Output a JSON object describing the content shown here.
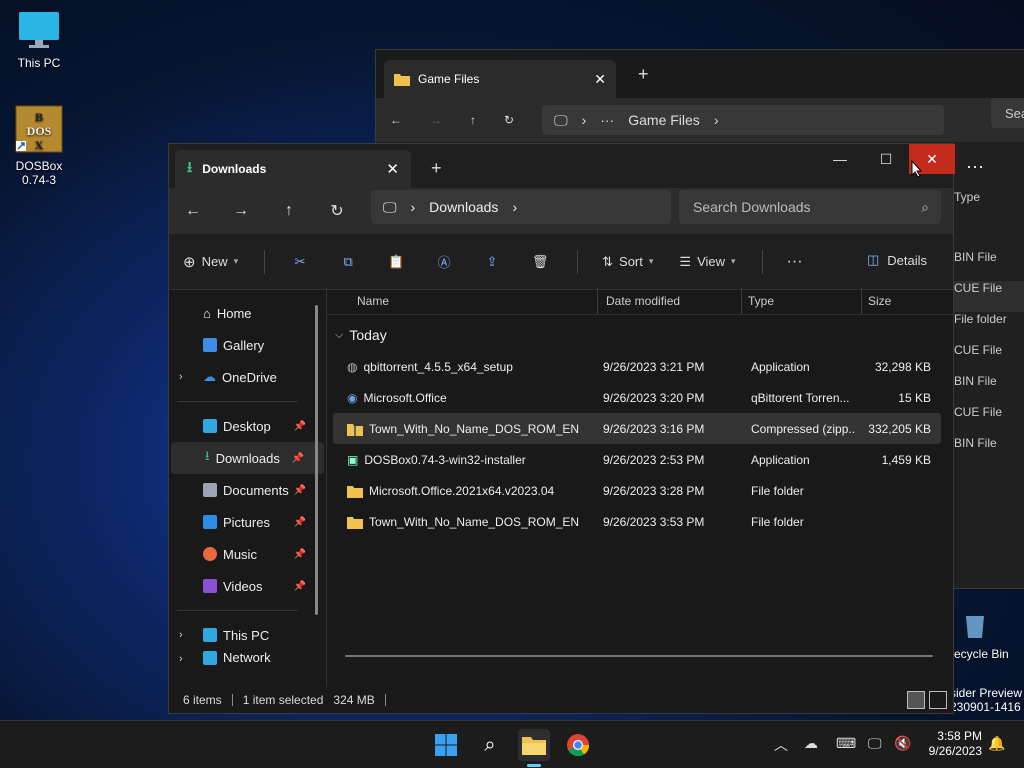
{
  "desktop": {
    "icons": [
      {
        "label": "This PC"
      },
      {
        "label": "DOSBox\n0.74-3",
        "line1": "DOSBox",
        "line2": "0.74-3"
      }
    ],
    "recycle_bin": "ecycle Bin",
    "watermark": {
      "line1": "sider Preview",
      "line2": "230901-1416"
    }
  },
  "bg_window": {
    "tab_title": "Game Files",
    "breadcrumb": "Game Files",
    "search_placeholder": "Sea",
    "type_header": "Type",
    "types": [
      "BIN File",
      "CUE File",
      "File folder",
      "CUE File",
      "BIN File",
      "CUE File",
      "BIN File"
    ]
  },
  "window": {
    "tab_title": "Downloads",
    "breadcrumb": "Downloads",
    "search_placeholder": "Search Downloads",
    "toolbar": {
      "new_label": "New",
      "sort_label": "Sort",
      "view_label": "View",
      "details_label": "Details"
    },
    "nav": {
      "home": "Home",
      "gallery": "Gallery",
      "onedrive": "OneDrive",
      "desktop": "Desktop",
      "downloads": "Downloads",
      "documents": "Documents",
      "pictures": "Pictures",
      "music": "Music",
      "videos": "Videos",
      "thispc": "This PC",
      "network": "Network"
    },
    "columns": {
      "name": "Name",
      "date": "Date modified",
      "type": "Type",
      "size": "Size"
    },
    "group": "Today",
    "files": [
      {
        "name": "qbittorrent_4.5.5_x64_setup",
        "date": "9/26/2023 3:21 PM",
        "type": "Application",
        "size": "32,298 KB"
      },
      {
        "name": "Microsoft.Office",
        "date": "9/26/2023 3:20 PM",
        "type": "qBittorent Torren...",
        "size": "15 KB"
      },
      {
        "name": "Town_With_No_Name_DOS_ROM_EN",
        "date": "9/26/2023 3:16 PM",
        "type": "Compressed (zipp...",
        "size": "332,205 KB"
      },
      {
        "name": "DOSBox0.74-3-win32-installer",
        "date": "9/26/2023 2:53 PM",
        "type": "Application",
        "size": "1,459 KB"
      },
      {
        "name": "Microsoft.Office.2021x64.v2023.04",
        "date": "9/26/2023 3:28 PM",
        "type": "File folder",
        "size": ""
      },
      {
        "name": "Town_With_No_Name_DOS_ROM_EN",
        "date": "9/26/2023 3:53 PM",
        "type": "File folder",
        "size": ""
      }
    ],
    "status": {
      "items": "6 items",
      "selected": "1 item selected",
      "size": "324 MB"
    }
  },
  "taskbar": {
    "time": "3:58 PM",
    "date": "9/26/2023"
  },
  "colors": {
    "accent": "#0078d4",
    "close_hover": "#c42b1c",
    "folder": "#f0c24b"
  }
}
